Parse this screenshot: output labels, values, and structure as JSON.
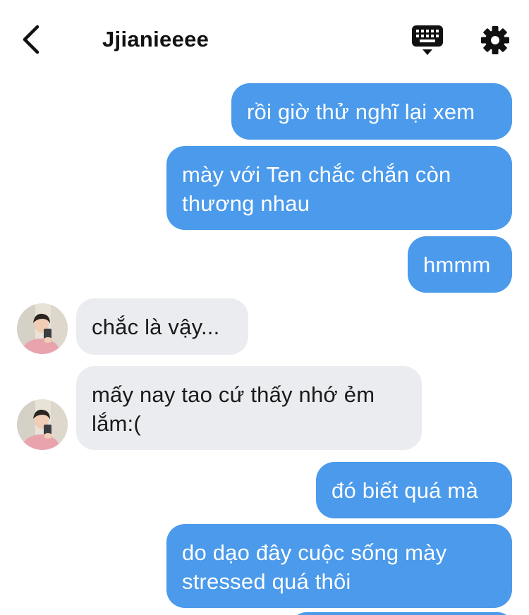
{
  "header": {
    "title": "Jjianieeee",
    "back_icon": "chevron-left-icon",
    "keyboard_icon": "keyboard-icon",
    "settings_icon": "gear-icon"
  },
  "colors": {
    "sent_bubble": "#4b9aeb",
    "received_bubble": "#ebecef",
    "icon": "#111111"
  },
  "messages": [
    {
      "direction": "sent",
      "text": "rồi giờ thử nghĩ lại xem"
    },
    {
      "direction": "sent",
      "text": "mày với Ten chắc chắn còn thương nhau"
    },
    {
      "direction": "sent",
      "text": "hmmm"
    },
    {
      "direction": "received",
      "text": "chắc là vậy..."
    },
    {
      "direction": "received",
      "text": "mấy nay tao cứ thấy nhớ ẻm lắm:("
    },
    {
      "direction": "sent",
      "text": "đó biết quá mà"
    },
    {
      "direction": "sent",
      "text": "do dạo đây cuộc sống mày stressed quá thôi"
    }
  ]
}
